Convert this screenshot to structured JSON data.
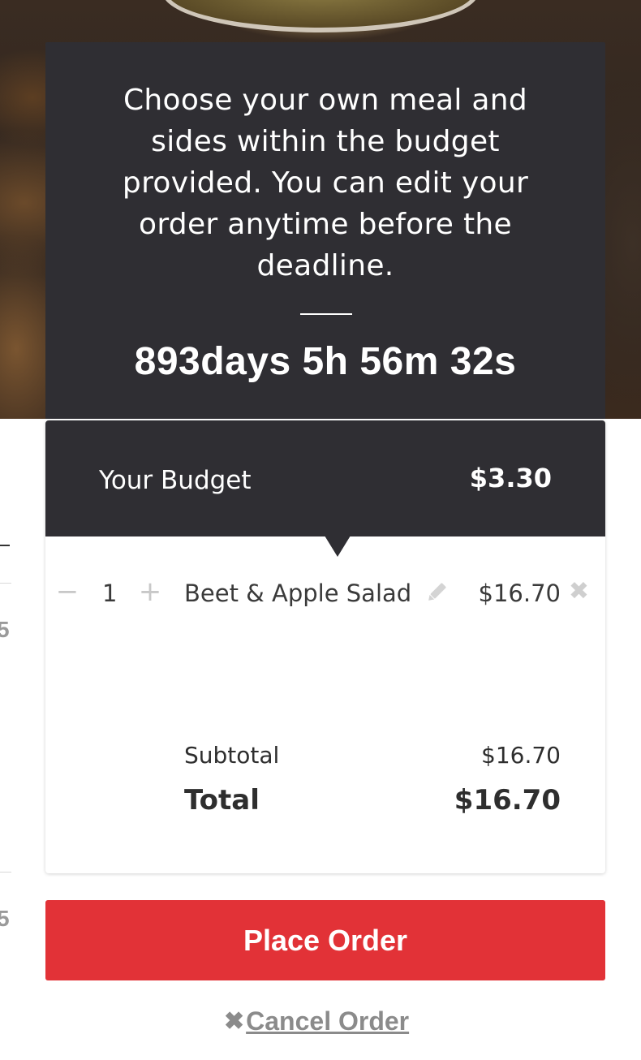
{
  "info": {
    "message": "Choose your own meal and sides within the budget provided. You can edit your order anytime before the deadline.",
    "countdown": "893days 5h 56m 32s"
  },
  "budget": {
    "label": "Your Budget",
    "value": "$3.30"
  },
  "order": {
    "items": [
      {
        "quantity": "1",
        "minus_symbol": "−",
        "plus_symbol": "+",
        "name": "Beet & Apple Salad",
        "price": "$16.70",
        "edit_icon": "pencil-icon",
        "remove_icon": "close-icon",
        "remove_symbol": "✖"
      }
    ],
    "subtotal_label": "Subtotal",
    "subtotal_value": "$16.70",
    "total_label": "Total",
    "total_value": "$16.70"
  },
  "actions": {
    "place_order_label": "Place Order",
    "cancel_symbol": "✖",
    "cancel_label": "Cancel Order"
  },
  "colors": {
    "dark_panel": "#2f2e33",
    "accent_red": "#e23237",
    "muted_gray": "#8b8b8b"
  }
}
